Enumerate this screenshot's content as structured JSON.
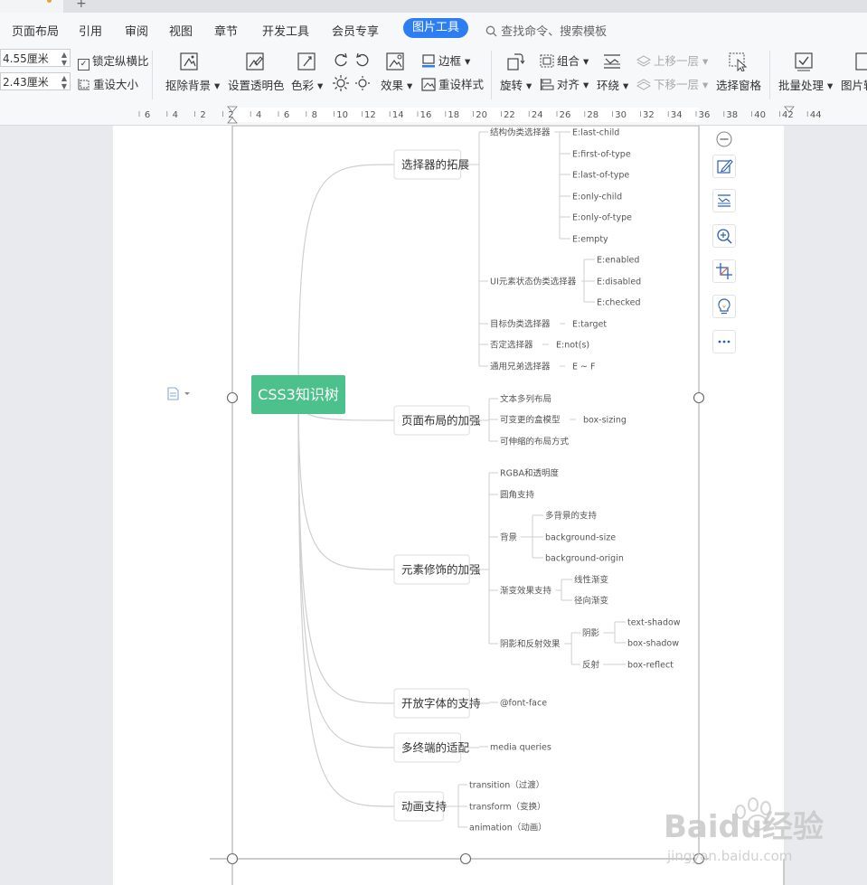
{
  "menu": {
    "items": [
      "页面布局",
      "引用",
      "审阅",
      "视图",
      "章节",
      "开发工具",
      "会员专享"
    ],
    "active_tab": "图片工具",
    "search_placeholder": "查找命令、搜索模板"
  },
  "ribbon": {
    "height_value": "4.55厘米",
    "width_value": "2.43厘米",
    "lock_ratio": "锁定纵横比",
    "reset_size": "重设大小",
    "remove_bg": "抠除背景",
    "set_transparent": "设置透明色",
    "color": "色彩",
    "effects": "效果",
    "border": "边框",
    "reset_style": "重设样式",
    "rotate": "旋转",
    "group": "组合",
    "align": "对齐",
    "wrap": "环绕",
    "bring_forward": "上移一层",
    "send_backward": "下移一层",
    "selection_pane": "选择窗格",
    "batch": "批量处理",
    "picture_more": "图片转"
  },
  "ruler": {
    "ticks": [
      "6",
      "4",
      "2",
      "2",
      "4",
      "6",
      "8",
      "10",
      "12",
      "14",
      "16",
      "18",
      "20",
      "22",
      "24",
      "26",
      "28",
      "30",
      "32",
      "34",
      "36",
      "38",
      "40",
      "42",
      "44"
    ]
  },
  "mindmap": {
    "root": "CSS3知识树",
    "branches": [
      {
        "label": "选择器的拓展",
        "children": [
          {
            "label": "结构伪类选择器",
            "children": [
              "E:last-child",
              "E:first-of-type",
              "E:last-of-type",
              "E:only-child",
              "E:only-of-type",
              "E:empty"
            ]
          },
          {
            "label": "UI元素状态伪类选择器",
            "children": [
              "E:enabled",
              "E:disabled",
              "E:checked"
            ]
          },
          {
            "label": "目标伪类选择器",
            "children": [
              "E:target"
            ]
          },
          {
            "label": "否定选择器",
            "children": [
              "E:not(s)"
            ]
          },
          {
            "label": "通用兄弟选择器",
            "children": [
              "E ~ F"
            ]
          }
        ]
      },
      {
        "label": "页面布局的加强",
        "children": [
          {
            "label": "文本多列布局",
            "children": []
          },
          {
            "label": "可变更的盒模型",
            "children": [
              "box-sizing"
            ]
          },
          {
            "label": "可伸缩的布局方式",
            "children": []
          }
        ]
      },
      {
        "label": "元素修饰的加强",
        "children": [
          {
            "label": "RGBA和透明度",
            "children": []
          },
          {
            "label": "圆角支持",
            "children": []
          },
          {
            "label": "背景",
            "children": [
              "多背景的支持",
              "background-size",
              "background-origin"
            ]
          },
          {
            "label": "渐变效果支持",
            "children": [
              "线性渐变",
              "径向渐变"
            ]
          },
          {
            "label": "阴影和反射效果",
            "children": [
              {
                "label": "阴影",
                "children": [
                  "text-shadow",
                  "box-shadow"
                ]
              },
              {
                "label": "反射",
                "children": [
                  "box-reflect"
                ]
              }
            ]
          }
        ]
      },
      {
        "label": "开放字体的支持",
        "children": [
          {
            "label": "@font-face",
            "children": []
          }
        ]
      },
      {
        "label": "多终端的适配",
        "children": [
          {
            "label": "media queries",
            "children": []
          }
        ]
      },
      {
        "label": "动画支持",
        "children": [
          {
            "label": "transition（过渡）",
            "children": []
          },
          {
            "label": "transform（变换）",
            "children": []
          },
          {
            "label": "animation（动画）",
            "children": []
          }
        ]
      }
    ]
  },
  "side_tools": [
    "minus-icon",
    "edit-icon",
    "text-wrap-icon",
    "zoom-icon",
    "crop-icon",
    "bulb-icon",
    "more-icon"
  ],
  "watermark": {
    "brand": "Baidu经验",
    "url": "jingyan.baidu.com"
  },
  "colors": {
    "root_green": "#4dc18b",
    "accent_blue": "#2d7ef2",
    "line_gray": "#cfcfcf"
  }
}
